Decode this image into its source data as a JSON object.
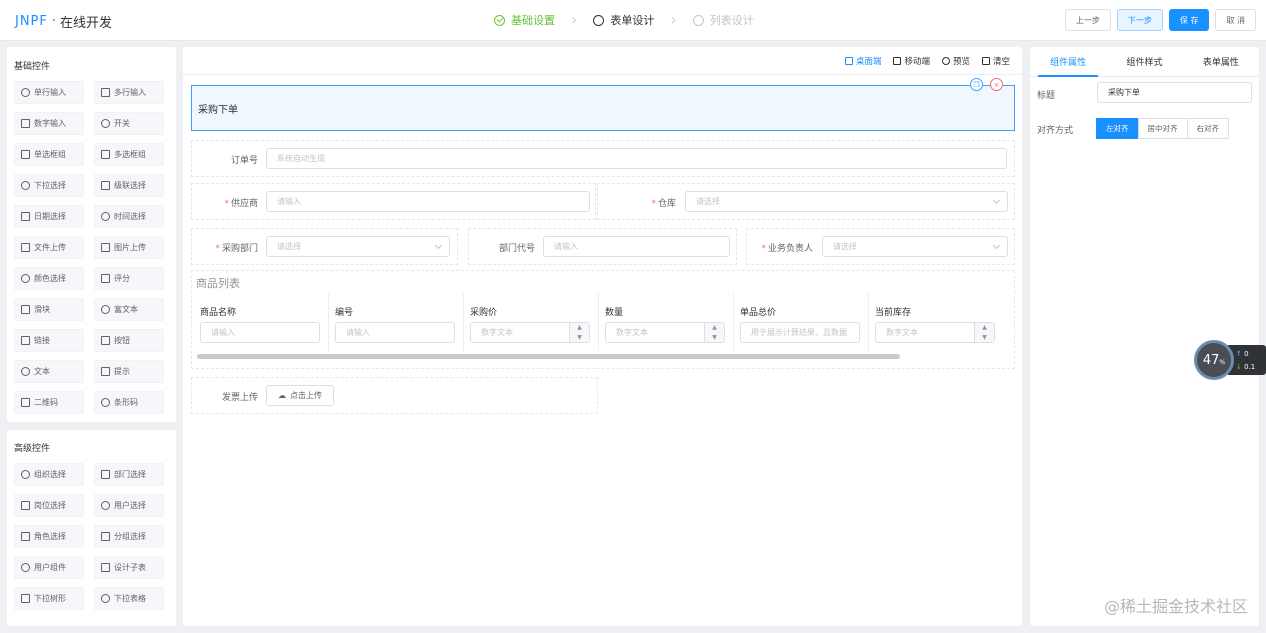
{
  "header": {
    "brand": "JNPF",
    "separator": "·",
    "app_title": "在线开发",
    "steps": [
      {
        "label": "基础设置",
        "state": "done"
      },
      {
        "label": "表单设计",
        "state": "active"
      },
      {
        "label": "列表设计",
        "state": "todo"
      }
    ],
    "buttons": {
      "prev": "上一步",
      "next": "下一步",
      "save": "保 存",
      "cancel": "取 消"
    }
  },
  "left": {
    "basic_title": "基础控件",
    "basic": [
      "单行输入",
      "多行输入",
      "数字输入",
      "开关",
      "单选框组",
      "多选框组",
      "下拉选择",
      "级联选择",
      "日期选择",
      "时间选择",
      "文件上传",
      "图片上传",
      "颜色选择",
      "评分",
      "滑块",
      "富文本",
      "链接",
      "按钮",
      "文本",
      "提示",
      "二维码",
      "条形码"
    ],
    "advanced_title": "高级控件",
    "advanced": [
      "组织选择",
      "部门选择",
      "岗位选择",
      "用户选择",
      "角色选择",
      "分组选择",
      "用户组件",
      "设计子表",
      "下拉树形",
      "下拉表格"
    ]
  },
  "canvas": {
    "toolbar": {
      "desktop": "桌面端",
      "mobile": "移动端",
      "preview": "预览",
      "clear": "清空"
    },
    "title": "采购下单",
    "order_no_label": "订单号",
    "order_no_placeholder": "系统自动生成",
    "supplier_label": "供应商",
    "supplier_placeholder": "请输入",
    "warehouse_label": "仓库",
    "warehouse_placeholder": "请选择",
    "dept_label": "采购部门",
    "dept_placeholder": "请选择",
    "dept_code_label": "部门代号",
    "dept_code_placeholder": "请输入",
    "owner_label": "业务负责人",
    "owner_placeholder": "请选择",
    "table_title": "商品列表",
    "columns": [
      {
        "header": "商品名称",
        "placeholder": "请输入"
      },
      {
        "header": "编号",
        "placeholder": "请输入"
      },
      {
        "header": "采购价",
        "placeholder": "数字文本"
      },
      {
        "header": "数量",
        "placeholder": "数字文本"
      },
      {
        "header": "单品总价",
        "placeholder": "用于展示计算结果，且数据"
      },
      {
        "header": "当前库存",
        "placeholder": "数字文本"
      }
    ],
    "invoice_label": "发票上传",
    "upload_button": "点击上传",
    "required_mark": "*"
  },
  "right": {
    "tabs": [
      "组件属性",
      "组件样式",
      "表单属性"
    ],
    "title_label": "标题",
    "title_value": "采购下单",
    "align_label": "对齐方式",
    "align_options": [
      "左对齐",
      "居中对齐",
      "右对齐"
    ]
  },
  "overlay": {
    "gauge": "47",
    "gauge_unit": "%",
    "up": "0",
    "down": "0.1"
  },
  "watermark": "@稀土掘金技术社区"
}
